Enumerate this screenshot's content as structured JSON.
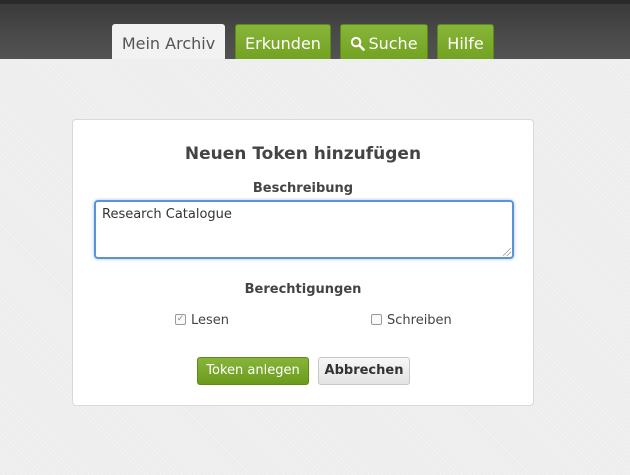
{
  "nav": {
    "tabs": [
      {
        "label": "Mein Archiv"
      },
      {
        "label": "Erkunden"
      },
      {
        "label": "Suche",
        "icon": "search-icon"
      },
      {
        "label": "Hilfe"
      }
    ]
  },
  "dialog": {
    "title": "Neuen Token hinzufügen",
    "description_label": "Beschreibung",
    "description_value": "Research Catalogue",
    "permissions_label": "Berechtigungen",
    "permissions": [
      {
        "label": "Lesen",
        "checked": true
      },
      {
        "label": "Schreiben",
        "checked": false
      }
    ],
    "submit_label": "Token anlegen",
    "cancel_label": "Abbrechen"
  },
  "colors": {
    "accent_green": "#72a01f",
    "focus_blue": "#5b93d6",
    "header_dark": "#444444"
  }
}
